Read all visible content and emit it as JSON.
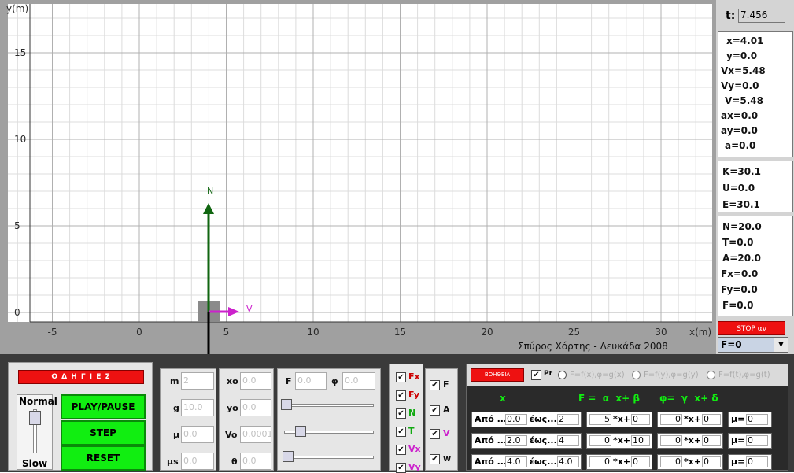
{
  "plot": {
    "y_axis_label": "y(m)",
    "x_axis_label": "x(m)",
    "x_ticks": [
      "-5",
      "0",
      "5",
      "10",
      "15",
      "20",
      "25",
      "30"
    ],
    "y_ticks": [
      "15",
      "10",
      "5",
      "0"
    ],
    "credit": "Σπύρος Χόρτης - Λευκάδα 2008",
    "normal_vector_label": "N",
    "velocity_vector_label": "V",
    "colors": {
      "normal": "#116611",
      "velocity": "#cc22cc",
      "block": "#888888",
      "weight": "#000000"
    }
  },
  "time": {
    "label": "t:",
    "value": "7.456"
  },
  "kinematics": [
    "x=4.01",
    "y=0.0",
    "Vx=5.48",
    "Vy=0.0",
    "V=5.48",
    "ax=0.0",
    "ay=0.0",
    "a=0.0"
  ],
  "energy": [
    "K=30.1",
    "U=0.0",
    "E=30.1"
  ],
  "forces": [
    "N=20.0",
    "T=0.0",
    "A=20.0",
    "Fx=0.0",
    "Fy=0.0",
    "F=0.0"
  ],
  "stop_button": "STOP αν",
  "force_select": "F=0",
  "controls": {
    "instructions": "Ο Δ Η Γ Ι Ε Σ",
    "speed_normal": "Normal",
    "speed_slow": "Slow",
    "play_pause": "PLAY/PAUSE",
    "step": "STEP",
    "reset": "RESET"
  },
  "params_left": [
    {
      "label": "m",
      "value": "2"
    },
    {
      "label": "g",
      "value": "10.0"
    },
    {
      "label": "μ",
      "value": "0.0"
    },
    {
      "label": "μs",
      "value": "0.0"
    }
  ],
  "params_mid": [
    {
      "label": "xo",
      "value": "0.0"
    },
    {
      "label": "yo",
      "value": "0.0"
    },
    {
      "label": "Vo",
      "value": "0.0001"
    },
    {
      "label": "θ",
      "value": "0.0"
    }
  ],
  "force_params": {
    "f_label": "F",
    "f_value": "0.0",
    "phi_label": "φ",
    "phi_value": "0.0"
  },
  "checks_left": [
    {
      "label": "Fx",
      "color": "#cc0000"
    },
    {
      "label": "Fy",
      "color": "#cc0000"
    },
    {
      "label": "N",
      "color": "#11aa11"
    },
    {
      "label": "T",
      "color": "#11aa11"
    },
    {
      "label": "Vx",
      "color": "#cc22cc"
    },
    {
      "label": "Vy",
      "color": "#cc22cc"
    }
  ],
  "checks_right": [
    {
      "label": "F",
      "color": "#111111"
    },
    {
      "label": "A",
      "color": "#111111"
    },
    {
      "label": "V",
      "color": "#cc22cc"
    },
    {
      "label": "w",
      "color": "#111111"
    }
  ],
  "func_panel": {
    "help": "ΒΟΗΘΕΙΑ",
    "pr_label": "Pr",
    "radios": [
      "F=f(x),φ=g(x)",
      "F=f(y),φ=g(y)",
      "F=f(t),φ=g(t)"
    ],
    "header_x": "x",
    "header_formula": "F =  α  x+ β      φ=  γ  x+ δ",
    "rows": [
      {
        "from_label": "Από ...",
        "from": "0.0",
        "to_label": "έως...",
        "to": "2",
        "a": "5",
        "b": "0",
        "g": "0",
        "d": "0",
        "mu_label": "μ=",
        "mu": "0"
      },
      {
        "from_label": "Από ...",
        "from": "2.0",
        "to_label": "έως...",
        "to": "4",
        "a": "0",
        "b": "10",
        "g": "0",
        "d": "0",
        "mu_label": "μ=",
        "mu": "0"
      },
      {
        "from_label": "Από ...",
        "from": "4.0",
        "to_label": "έως...",
        "to": "4.0",
        "a": "0",
        "b": "0",
        "g": "0",
        "d": "0",
        "mu_label": "μ=",
        "mu": "0"
      }
    ],
    "x_plus": "*x+"
  }
}
